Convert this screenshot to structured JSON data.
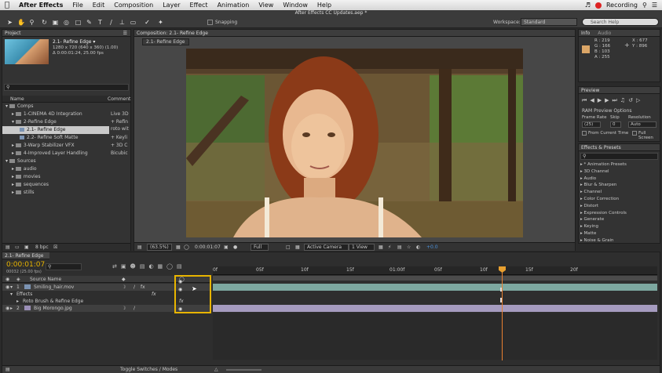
{
  "menubar": {
    "app_name": "After Effects",
    "items": [
      "File",
      "Edit",
      "Composition",
      "Layer",
      "Effect",
      "Animation",
      "View",
      "Window",
      "Help"
    ],
    "recording": "Recording",
    "window_title": "After Effects CC Updates.aep *"
  },
  "toolbar": {
    "snapping": "Snapping",
    "workspace_label": "Workspace:",
    "workspace_value": "Standard",
    "search_placeholder": "Search Help"
  },
  "project": {
    "tab": "Project",
    "thumb_name": "2.1- Refine Edge ▾",
    "thumb_info1": "1280 x 720  (640 x 360) (1.00)",
    "thumb_info2": "Δ 0:00:01:24, 25.00 fps",
    "col_name": "Name",
    "col_comment": "Comment",
    "rows": [
      {
        "label": "Comps",
        "comment": ""
      },
      {
        "label": "1-CINEMA 4D Integration",
        "comment": "Live 3D"
      },
      {
        "label": "2-Refine Edge",
        "comment": "+ Refin"
      },
      {
        "label": "2.1- Refine Edge",
        "comment": "roto wit"
      },
      {
        "label": "2.2- Refine Soft Matte",
        "comment": "+ Keyli"
      },
      {
        "label": "3-Warp Stabilizer VFX",
        "comment": "+ 3D C"
      },
      {
        "label": "4-Improved Layer Handling",
        "comment": "Bicubic"
      },
      {
        "label": "Sources",
        "comment": ""
      },
      {
        "label": "audio",
        "comment": ""
      },
      {
        "label": "movies",
        "comment": ""
      },
      {
        "label": "sequences",
        "comment": ""
      },
      {
        "label": "stills",
        "comment": ""
      }
    ],
    "bpc": "8 bpc"
  },
  "composition": {
    "tab": "Composition: 2.1- Refine Edge",
    "subtab": "2.1- Refine Edge",
    "zoom": "(63.5%)",
    "timecode": "0:00:01:07",
    "resolution": "Full",
    "camera": "Active Camera",
    "view": "1 View",
    "exposure": "+0.0"
  },
  "info": {
    "tab": "Info",
    "tab2": "Audio",
    "r": "R : 219",
    "g": "G : 166",
    "b": "B : 103",
    "a": "A : 255",
    "x": "X : 677",
    "y": "Y : 896"
  },
  "preview": {
    "tab": "Preview",
    "ram_options": "RAM Preview Options",
    "frame_rate": "Frame Rate",
    "skip": "Skip",
    "resolution": "Resolution",
    "fr_value": "(25)",
    "skip_value": "0",
    "res_value": "Auto",
    "from_current": "From Current Time",
    "full_screen": "Full Screen"
  },
  "effects": {
    "tab": "Effects & Presets",
    "items": [
      "* Animation Presets",
      "3D Channel",
      "Audio",
      "Blur & Sharpen",
      "Channel",
      "Color Correction",
      "Distort",
      "Expression Controls",
      "Generate",
      "Keying",
      "Matte",
      "Noise & Grain"
    ]
  },
  "timeline": {
    "tab": "2.1- Refine Edge",
    "timecode": "0:00:01:07",
    "frame_info": "00032 (25.00 fps)",
    "col_source": "Source Name",
    "layers": [
      {
        "num": "1",
        "name": "Smiling_hair.mov"
      },
      {
        "num": "",
        "name": "Effects"
      },
      {
        "num": "",
        "name": "Roto Brush & Refine Edge"
      },
      {
        "num": "2",
        "name": "Big Morongo.jpg"
      }
    ],
    "ticks": [
      "0f",
      "05f",
      "10f",
      "15f",
      "01:00f",
      "05f",
      "10f",
      "15f",
      "20f"
    ],
    "toggle_label": "Toggle Switches / Modes"
  },
  "colors": {
    "highlight": "#e8b400",
    "playhead": "#e8a030",
    "accent_blue": "#4a90d9"
  }
}
